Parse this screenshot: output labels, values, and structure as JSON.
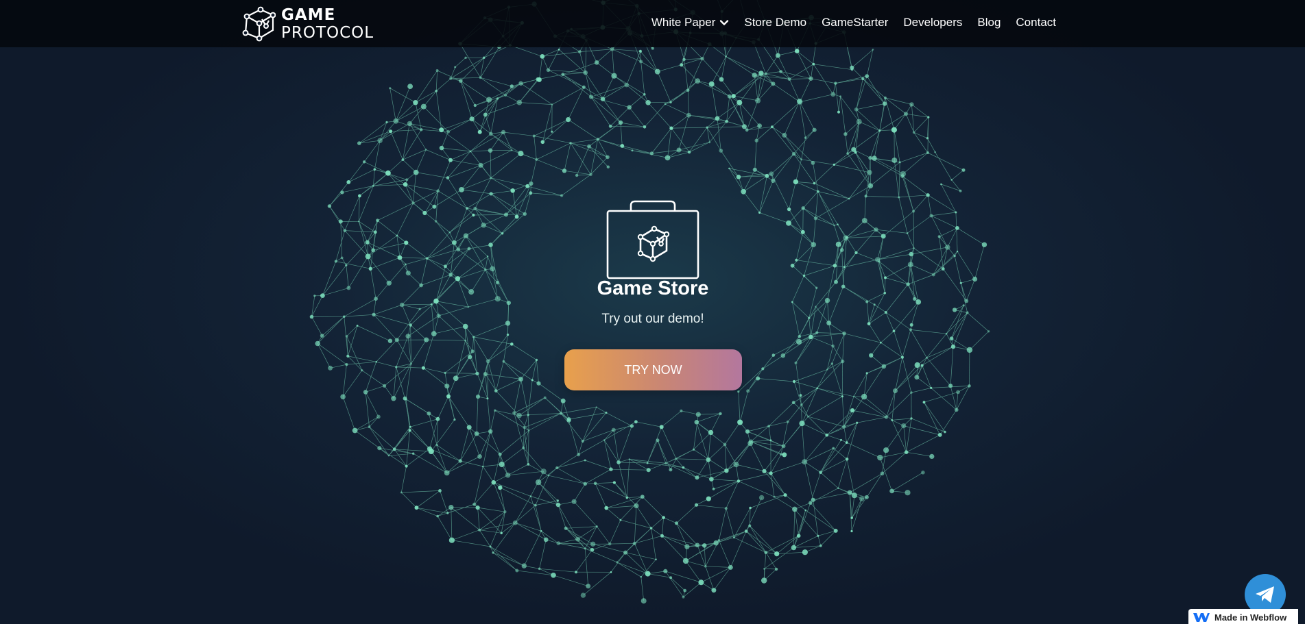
{
  "logo": {
    "line1": "GAME",
    "line2": "PROTOCOL",
    "icon": "cube-network-icon"
  },
  "nav": {
    "items": [
      {
        "label": "White Paper",
        "has_dropdown": true
      },
      {
        "label": "Store Demo"
      },
      {
        "label": "GameStarter"
      },
      {
        "label": "Developers"
      },
      {
        "label": "Blog"
      },
      {
        "label": "Contact"
      }
    ]
  },
  "hero": {
    "icon": "store-bag-icon",
    "title": "Game Store",
    "subtitle": "Try out our demo!",
    "cta_label": "TRY NOW"
  },
  "floating": {
    "telegram_icon": "telegram-icon",
    "webflow_label": "Made in Webflow"
  },
  "colors": {
    "network": "#7fe3c0",
    "button_start": "#e8a04c",
    "button_end": "#b3779e",
    "telegram": "#2f8fd8"
  }
}
